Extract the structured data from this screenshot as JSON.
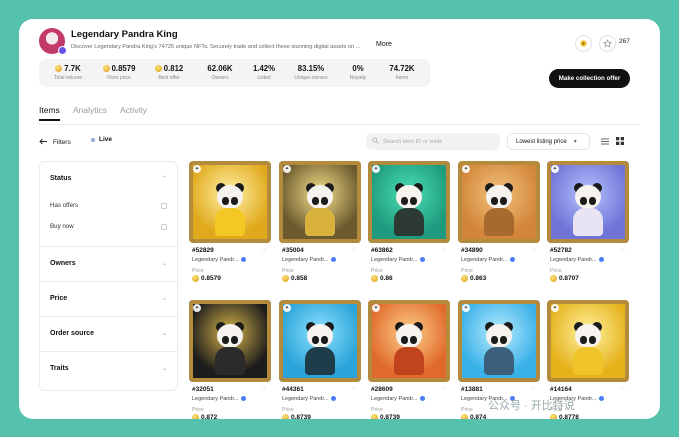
{
  "collection": {
    "title": "Legendary Pandra King",
    "description": "Discover Legendary Pandra King's 74725 unique NFTs. Securely trade and collect these stunning digital assets on ...",
    "more_label": "More",
    "watch_count": "267"
  },
  "stats": [
    {
      "value": "7.7K",
      "label": "Total volume",
      "coin": true
    },
    {
      "value": "0.8579",
      "label": "Floor price",
      "coin": true
    },
    {
      "value": "0.812",
      "label": "Best offer",
      "coin": true
    },
    {
      "value": "62.06K",
      "label": "Owners",
      "coin": false
    },
    {
      "value": "1.42%",
      "label": "Listed",
      "coin": false
    },
    {
      "value": "83.15%",
      "label": "Unique owners",
      "coin": false
    },
    {
      "value": "0%",
      "label": "Royalty",
      "coin": false
    },
    {
      "value": "74.72K",
      "label": "Items",
      "coin": false
    }
  ],
  "make_offer_label": "Make collection offer",
  "tabs": [
    "Items",
    "Analytics",
    "Activity"
  ],
  "toolbar": {
    "filters_label": "Filters",
    "live_label": "Live",
    "search_placeholder": "Search item ID or traits",
    "sort_label": "Lowest listing price"
  },
  "sidebar": {
    "status_label": "Status",
    "options": [
      "Has offers",
      "Buy now"
    ],
    "sections": [
      "Owners",
      "Price",
      "Order source",
      "Traits"
    ]
  },
  "price_label": "Price",
  "items": [
    {
      "id": "#52829",
      "collection": "Legendary Pandr...",
      "price": "0.8579",
      "bg": "#e0a91b",
      "body": "#f3c824",
      "accent": "#fff2a8"
    },
    {
      "id": "#35004",
      "collection": "Legendary Pandr...",
      "price": "0.858",
      "bg": "#6b5a2e",
      "body": "#d9b23c",
      "accent": "#f7e08a"
    },
    {
      "id": "#63862",
      "collection": "Legendary Pandr...",
      "price": "0.86",
      "bg": "#1f9a7e",
      "body": "#2c3a33",
      "accent": "#49e0b4"
    },
    {
      "id": "#34890",
      "collection": "Legendary Pandr...",
      "price": "0.863",
      "bg": "#d2863a",
      "body": "#a8692f",
      "accent": "#f2c27c"
    },
    {
      "id": "#52782",
      "collection": "Legendary Pandr...",
      "price": "0.8707",
      "bg": "#6f74d6",
      "body": "#e8e4f6",
      "accent": "#b7c4ff"
    },
    {
      "id": "#32051",
      "collection": "Legendary Pandr...",
      "price": "0.872",
      "bg": "#1c1c1c",
      "body": "#2b2b2b",
      "accent": "#d8b54a"
    },
    {
      "id": "#44361",
      "collection": "Legendary Pandr...",
      "price": "0.8739",
      "bg": "#2aa4d8",
      "body": "#1e3d4a",
      "accent": "#8ee2ff"
    },
    {
      "id": "#28609",
      "collection": "Legendary Pandr...",
      "price": "0.8739",
      "bg": "#e06a2c",
      "body": "#c2441f",
      "accent": "#ffd08a"
    },
    {
      "id": "#13881",
      "collection": "Legendary Pandr...",
      "price": "0.874",
      "bg": "#39b0e8",
      "body": "#3b5f7a",
      "accent": "#b8ecff"
    },
    {
      "id": "#14164",
      "collection": "Legendary Pandr...",
      "price": "0.8778",
      "bg": "#e5b21c",
      "body": "#f0c52a",
      "accent": "#fff3a0"
    }
  ],
  "watermark": "公众号 · 开比特说"
}
